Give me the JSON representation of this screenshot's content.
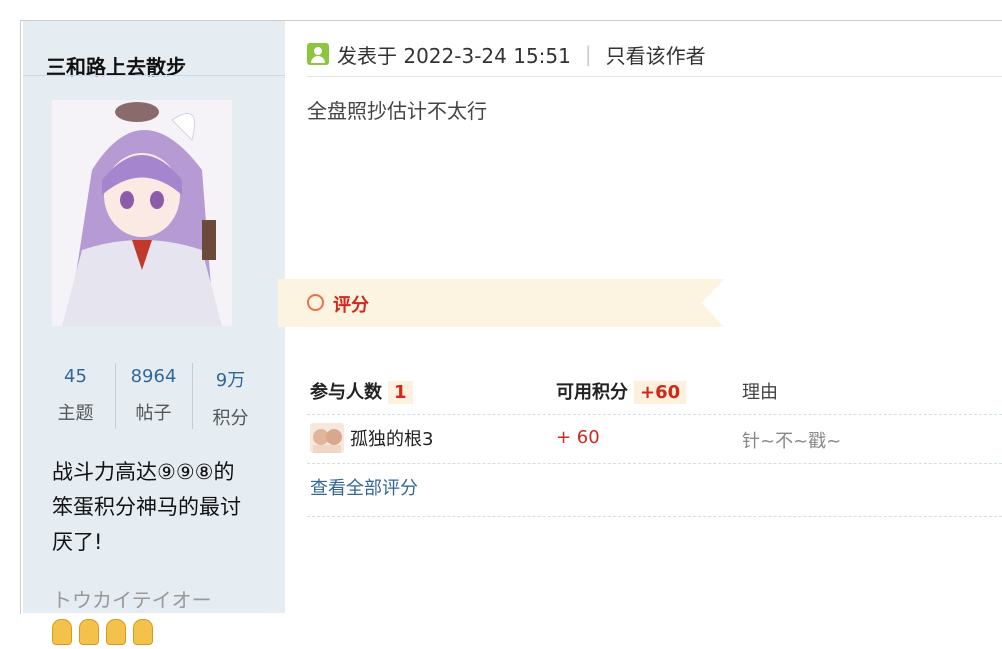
{
  "author": {
    "username": "三和路上去散步",
    "stats": [
      {
        "value": "45",
        "label": "主题"
      },
      {
        "value": "8964",
        "label": "帖子"
      },
      {
        "value": "9万",
        "label": "积分"
      }
    ],
    "bio": "战斗力高达⑨⑨⑧的笨蛋积分神马的最讨厌了!",
    "custom_title": "トウカイテイオー"
  },
  "post": {
    "posted_label": "发表于 2022-3-24 15:51",
    "author_only": "只看该作者",
    "content": "全盘照抄估计不太行"
  },
  "rating": {
    "title": "评分",
    "col_participants": "参与人数",
    "participants": "1",
    "col_points": "可用积分",
    "points_total": "+60",
    "col_reason": "理由",
    "entries": [
      {
        "user": "孤独的根3",
        "score": "+ 60",
        "reason": "针~不~戳~"
      }
    ],
    "view_all": "查看全部评分"
  },
  "colors": {
    "sidebar_bg": "#e5edf2",
    "accent_red": "#d2271b",
    "link_blue": "#336699",
    "banner_bg": "#fdf3e1"
  }
}
